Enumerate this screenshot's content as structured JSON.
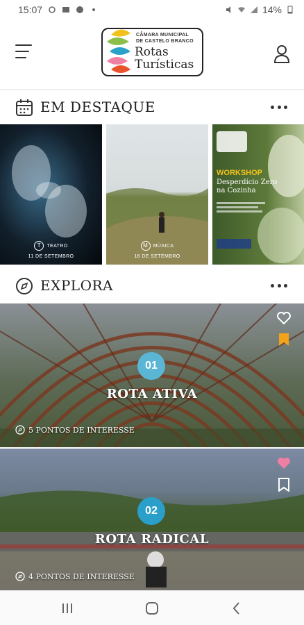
{
  "status_bar": {
    "time": "15:07",
    "battery": "14%"
  },
  "header": {
    "menu_icon": "hamburger-menu-icon",
    "user_icon": "user-icon",
    "logo": {
      "line1": "CÂMARA MUNICIPAL",
      "line2": "DE CASTELO BRANCO",
      "title_line1": "Rotas",
      "title_line2": "Turísticas"
    }
  },
  "featured": {
    "title": "EM DESTAQUE",
    "icon": "calendar-icon",
    "cards": [
      {
        "category_letter": "T",
        "category": "TEATRO",
        "date": "11 DE SETEMBRO"
      },
      {
        "category_letter": "M",
        "category": "MÚSICA",
        "date": "16 DE SETEMBRO"
      },
      {
        "poster_heading": "WORKSHOP",
        "poster_title_1": "Desperdício Zero",
        "poster_title_2": "na Cozinha"
      }
    ]
  },
  "explore": {
    "title": "EXPLORA",
    "icon": "compass-icon",
    "routes": [
      {
        "number": "01",
        "name": "ROTA ATIVA",
        "points": "5 PONTOS DE INTERESSE",
        "favorited": false,
        "bookmarked": true,
        "number_color": "#5bb6d6"
      },
      {
        "number": "02",
        "name": "ROTA RADICAL",
        "points": "4 PONTOS DE INTERESSE",
        "favorited": true,
        "bookmarked": false,
        "number_color": "#2a9fc9"
      }
    ]
  },
  "colors": {
    "bookmark_active": "#f2a31b",
    "favorite_active": "#ef7fa3"
  }
}
